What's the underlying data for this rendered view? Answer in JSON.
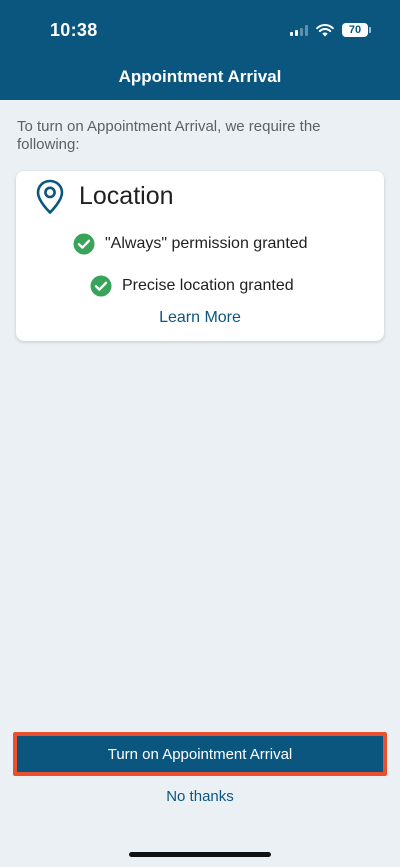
{
  "status_bar": {
    "time": "10:38",
    "battery": "70",
    "icons": [
      "signal-icon",
      "wifi-icon",
      "battery-icon"
    ]
  },
  "header": {
    "title": "Appointment Arrival",
    "background": "#0b567f"
  },
  "intro_text": "To turn on Appointment Arrival, we require the following:",
  "location_card": {
    "icon": "location-pin-icon",
    "title": "Location",
    "requirements": [
      {
        "label": "\"Always\" permission granted",
        "icon": "check-circle-icon",
        "status_color": "#3aa35a"
      },
      {
        "label": "Precise location granted",
        "icon": "check-circle-icon",
        "status_color": "#3aa35a"
      }
    ],
    "learn_more": "Learn More"
  },
  "actions": {
    "primary_label": "Turn on Appointment Arrival",
    "secondary_label": "No thanks",
    "highlight_color": "#e9512e"
  }
}
